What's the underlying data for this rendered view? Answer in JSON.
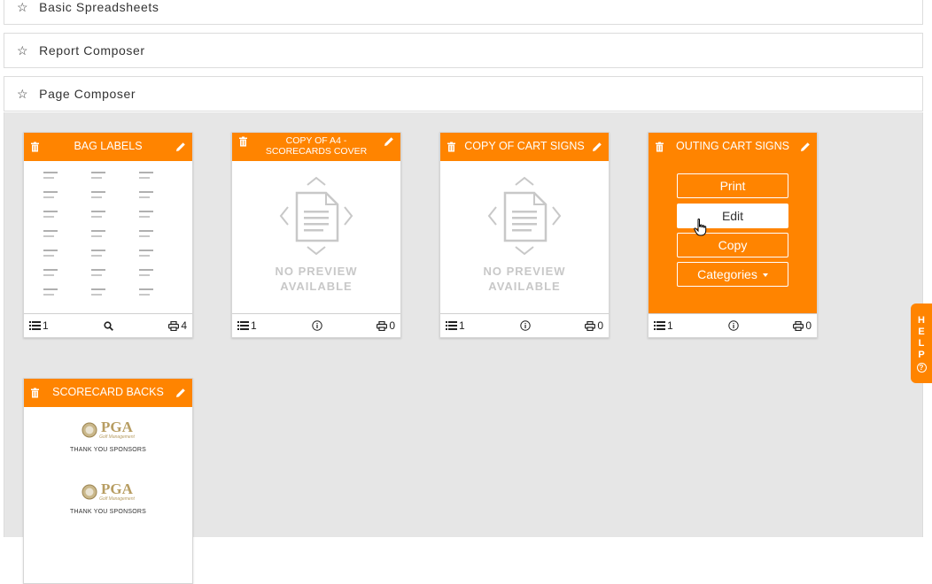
{
  "sections": [
    {
      "label": "Basic Spreadsheets"
    },
    {
      "label": "Report Composer"
    },
    {
      "label": "Page Composer"
    }
  ],
  "cards": [
    {
      "title": "BAG LABELS",
      "preview": "labels",
      "footer": {
        "layers": "1",
        "prints": "4"
      }
    },
    {
      "title": "COPY OF A4 - SCORECARDS COVER",
      "preview": "none",
      "footer": {
        "layers": "1",
        "prints": "0"
      }
    },
    {
      "title": "COPY OF CART SIGNS",
      "preview": "none",
      "footer": {
        "layers": "1",
        "prints": "0"
      }
    },
    {
      "title": "OUTING CART SIGNS",
      "preview": "actions",
      "footer": {
        "layers": "1",
        "prints": "0"
      }
    },
    {
      "title": "SCORECARD BACKS",
      "preview": "sponsors"
    }
  ],
  "no_preview": {
    "line1": "NO PREVIEW",
    "line2": "AVAILABLE"
  },
  "actions": {
    "print": "Print",
    "edit": "Edit",
    "copy": "Copy",
    "categories": "Categories"
  },
  "sponsor": {
    "logo_text": "PGA",
    "logo_sub": "Golf Management",
    "thanks": "THANK YOU SPONSORS"
  },
  "help": {
    "letters": [
      "H",
      "E",
      "L",
      "P"
    ],
    "q": "?"
  },
  "colors": {
    "accent": "#ff8400",
    "panel_bg": "#e6e6e6",
    "muted": "#c8c8c8",
    "logo_gold": "#b79d62"
  },
  "icons": {
    "section": "star-outline-icon",
    "card_delete": "trash-icon",
    "card_edit": "pencil-icon",
    "footer_layers": "list-icon",
    "footer_preview": "search-icon",
    "footer_info": "info-icon",
    "footer_print": "printer-icon"
  }
}
